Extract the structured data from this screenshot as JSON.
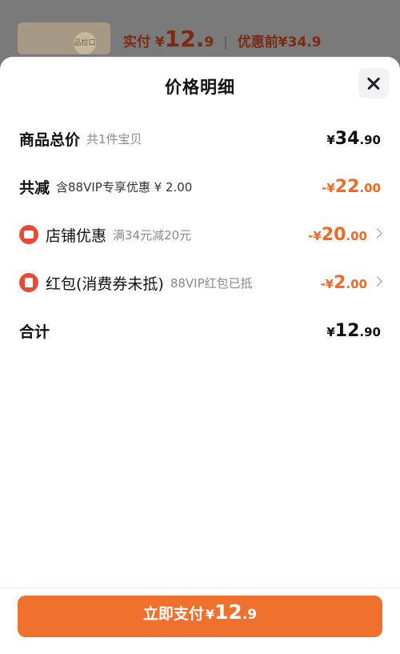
{
  "background": {
    "thumb_label": "品拉口",
    "price_prefix": "实付",
    "price_currency": "¥",
    "price_int": "12.",
    "price_dec": "9",
    "separator": "|",
    "original_label": "优惠前",
    "original_price": "¥34.9"
  },
  "sheet": {
    "title": "价格明细"
  },
  "rows": [
    {
      "label": "商品总价",
      "sub": "共1件宝贝",
      "currency": "¥",
      "int": "34",
      "dec": ".90"
    },
    {
      "label": "共减",
      "sub": "含88VIP专享优惠 ¥ 2.00",
      "currency": "-¥",
      "int": "22",
      "dec": ".00"
    },
    {
      "label": "店铺优惠",
      "sub": "满34元减20元",
      "currency": "-¥",
      "int": "20",
      "dec": ".00"
    },
    {
      "label": "红包(消费券未抵)",
      "sub": "88VIP红包已抵",
      "currency": "-¥",
      "int": "2",
      "dec": ".00"
    },
    {
      "label": "合计",
      "currency": "¥",
      "int": "12",
      "dec": ".90"
    }
  ],
  "pay_button": {
    "text": "立即支付",
    "currency": "¥",
    "int": "12",
    "dec": ".9"
  },
  "colors": {
    "accent": "#f06a25",
    "badge": "#e84a35"
  },
  "icons": [
    "close-icon",
    "shop-icon",
    "red-packet-icon",
    "chevron-right-icon"
  ]
}
